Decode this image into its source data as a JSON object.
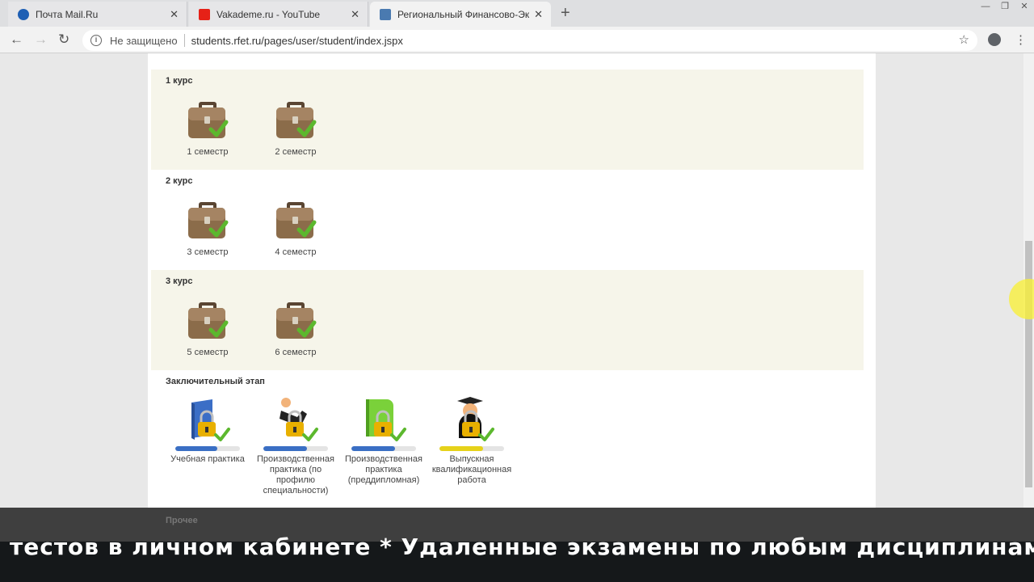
{
  "browser": {
    "tabs": [
      {
        "title": "Почта Mail.Ru",
        "active": false
      },
      {
        "title": "Vakademe.ru - YouTube",
        "active": false
      },
      {
        "title": "Региональный Финансово-Экон",
        "active": true
      }
    ],
    "security_label": "Не защищено",
    "url": "students.rfet.ru/pages/user/student/index.jspx"
  },
  "courses": [
    {
      "title": "1 курс",
      "semesters": [
        "1 семестр",
        "2 семестр"
      ]
    },
    {
      "title": "2 курс",
      "semesters": [
        "3 семестр",
        "4 семестр"
      ]
    },
    {
      "title": "3 курс",
      "semesters": [
        "5 семестр",
        "6 семестр"
      ]
    }
  ],
  "final_stage": {
    "title": "Заключительный этап",
    "items": [
      {
        "label": "Учебная практика",
        "icon": "book-lock-icon",
        "bar_color": "#3a6fc4",
        "progress": 0.65
      },
      {
        "label": "Производственная практика (по профилю специальности)",
        "icon": "worker-lock-icon",
        "bar_color": "#3a6fc4",
        "progress": 0.68
      },
      {
        "label": "Производственная практика (преддипломная)",
        "icon": "green-book-lock-icon",
        "bar_color": "#3a6fc4",
        "progress": 0.68
      },
      {
        "label": "Выпускная квалификационная работа",
        "icon": "graduate-lock-icon",
        "bar_color": "#e6d21a",
        "progress": 0.68
      }
    ]
  },
  "other_section": {
    "title": "Прочее"
  },
  "banner": {
    "ticker": "тестов в личном кабинете  *  Удаленные экзамены по любым дисциплинам  *  С"
  },
  "colors": {
    "shaded_section": "#f6f5ea",
    "check": "#5cb82e",
    "briefcase": "#8b6c4a"
  }
}
